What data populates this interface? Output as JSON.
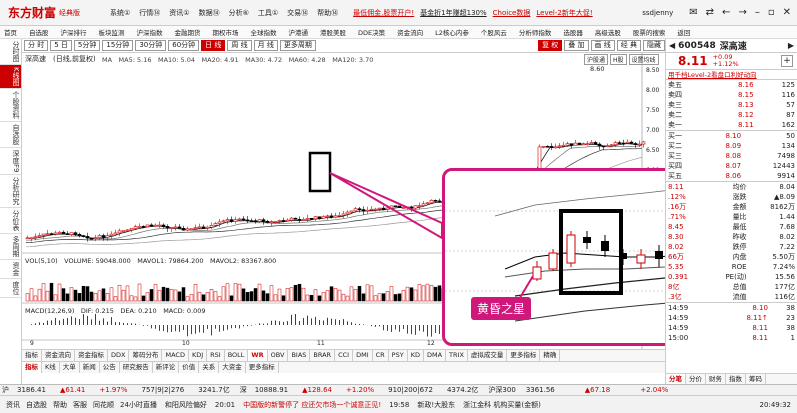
{
  "app": {
    "logo": "东方财富",
    "edition": "经典版",
    "menu": [
      "系统①",
      "行情⑭",
      "资讯①",
      "数据⑭",
      "分析⑥",
      "工具①",
      "交易⑭",
      "帮助⑭"
    ],
    "promo": "最低佣金,股票开户!",
    "promo2": "基金折1年赚超130%",
    "promo3": "Choice数据",
    "promo4": "Level-2新年大促!",
    "user": "ssdjenny",
    "win_buttons": [
      "✉",
      "⇄",
      "←",
      "→",
      "–",
      "▫",
      "✕"
    ]
  },
  "navbar": [
    "首页",
    "自选股",
    "沪深排行",
    "板块监测",
    "沪深指数",
    "金融期货",
    "期权市场",
    "全球指数",
    "沪港通",
    "港股美股",
    "DDE决策",
    "资金流向",
    "L2核心内参",
    "个股风云",
    "分析师指数",
    "选股器",
    "高级选股",
    "股票的搜索",
    "",
    "返回"
  ],
  "leftrail": [
    "分时图",
    "K线图",
    "个股资料",
    "自选股",
    "深度F9",
    "分析研究",
    "分价表",
    "多周期",
    "资金",
    "度位"
  ],
  "toolbar": {
    "buttons": [
      "分 时",
      "5 日",
      "5分钟",
      "15分钟",
      "30分钟",
      "60分钟",
      "日 线",
      "周 线",
      "月 线",
      "更多周期"
    ],
    "active_index": 6,
    "right": [
      "复 权",
      "叠 加",
      "画 线",
      "经 典",
      "隐藏"
    ]
  },
  "chart": {
    "header": "深高速　(日线,前复权)",
    "ma_text": "MA　MA5: 5.16　MA10: 5.04　MA20: 4.91　MA30: 4.72　MA60: 4.28　MA120: 3.70",
    "peak_label": "8.60",
    "hk_tags": [
      "沪股通",
      "H股",
      "设置均线"
    ],
    "price_axis": [
      "8.50",
      "8.00",
      "7.50",
      "7.00",
      "6.50",
      "6.00"
    ],
    "vol_header": "VOL(5,10)　VOLUME: 59048.000　MAVOL1: 79864.200　MAVOL2: 83367.800",
    "macd_header": "MACD(12,26,9)　DIF: 0.215　DEA: 0.210　MACD: 0.009",
    "x_labels": [
      "9",
      "10",
      "11",
      "12",
      "2015"
    ],
    "callout": "黄昏之星"
  },
  "bottom_tabs1": [
    "指标",
    "K线",
    "大单",
    "新闻",
    "公告",
    "研究报告",
    "新评论",
    "价值",
    "关系",
    "大资金",
    "更多指标"
  ],
  "bottom_tabs2": [
    "指标",
    "常用指标",
    "成交量",
    "均线",
    "资金流向",
    "资金指标",
    "DDX",
    "DDY",
    "DDZ",
    "BOLL",
    "MA",
    "CCI",
    "DMI",
    "CR",
    "PSY",
    "KD",
    "DMA",
    "TRIX",
    "更多指标"
  ],
  "bottom_tabs2b": [
    "指标",
    "资金流向",
    "资金指标",
    "DDX",
    "筹码分布",
    "MACD",
    "KDJ",
    "RSI",
    "BOLL",
    "WR",
    "OBV",
    "BIAS",
    "BRAR",
    "CCI",
    "DMI",
    "CR",
    "PSY",
    "KD",
    "DMA",
    "TRIX",
    "虚拟成交量",
    "更多指标",
    "精确"
  ],
  "quote": {
    "code": "600548",
    "name": "深高速",
    "price": "8.11",
    "change": "+0.09",
    "pct": "+1.12%",
    "l2": "用千档Level-2看盘口利好动向",
    "asks": [
      {
        "label": "卖五",
        "price": "8.16",
        "vol": "125"
      },
      {
        "label": "卖四",
        "price": "8.15",
        "vol": "116"
      },
      {
        "label": "卖三",
        "price": "8.13",
        "vol": "57"
      },
      {
        "label": "卖二",
        "price": "8.12",
        "vol": "87"
      },
      {
        "label": "卖一",
        "price": "8.11",
        "vol": "162"
      }
    ],
    "bids": [
      {
        "label": "买一",
        "price": "8.10",
        "vol": "50"
      },
      {
        "label": "买二",
        "price": "8.09",
        "vol": "134"
      },
      {
        "label": "买三",
        "price": "8.08",
        "vol": "7498"
      },
      {
        "label": "买四",
        "price": "8.07",
        "vol": "12443"
      },
      {
        "label": "买五",
        "price": "8.06",
        "vol": "9914"
      }
    ],
    "stats": [
      [
        "8.11",
        "均价",
        "8.04"
      ],
      [
        ".12%",
        "涨跌",
        "▲8.09"
      ],
      [
        ".16万",
        "金额",
        "8162万"
      ],
      [
        ".71%",
        "量比",
        "1.44"
      ],
      [
        "8.45",
        "最低",
        "7.68"
      ],
      [
        "8.30",
        "昨收",
        "8.02"
      ],
      [
        "8.02",
        "跌停",
        "7.22"
      ],
      [
        "66万",
        "内盘",
        "5.50万"
      ],
      [
        "5.35",
        "ROE",
        "7.24%"
      ],
      [
        "0.391",
        "PE(动)",
        "15.56"
      ],
      [
        "8亿",
        "总值",
        "177亿"
      ],
      [
        ".3亿",
        "流值",
        "116亿"
      ]
    ],
    "trades": [
      [
        "14:59",
        "8.10",
        "38"
      ],
      [
        "14:59",
        "8.11↑",
        "23"
      ],
      [
        "14:59",
        "8.11",
        "38"
      ],
      [
        "15:00",
        "8.11",
        "1"
      ]
    ],
    "right_tabs": [
      "分笔",
      "分价",
      "财务",
      "指数",
      "筹码"
    ]
  },
  "index_bar": {
    "sh_label": "沪",
    "sh": "3186.41",
    "sh_chg": "▲61.41",
    "sh_pct": "+1.97%",
    "sh_amt": "757|9|2|276",
    "sh_vol": "3241.7亿",
    "sz_label": "深",
    "sz": "10888.91",
    "sz_chg": "▲128.64",
    "sz_pct": "+1.20%",
    "sz_amt": "910|200|672",
    "sz_vol": "4374.2亿",
    "cy_label": "沪深300",
    "cy": "3361.56",
    "cy_chg": "▲67.18",
    "cy_pct": "+2.04%"
  },
  "ticker": {
    "items": [
      "资讯",
      "自选股",
      "帮助",
      "客服",
      "同花顺",
      "24小时直播"
    ],
    "news1": "和阳风险偏好",
    "time1": "20:01",
    "news2": "中国版的新警停了 应还欠市场一个诚意正见!",
    "time2": "19:58",
    "news3": "新政!大股东",
    "news4": "浙江金科 机构买量(金额)",
    "clock": "20:49:32"
  }
}
